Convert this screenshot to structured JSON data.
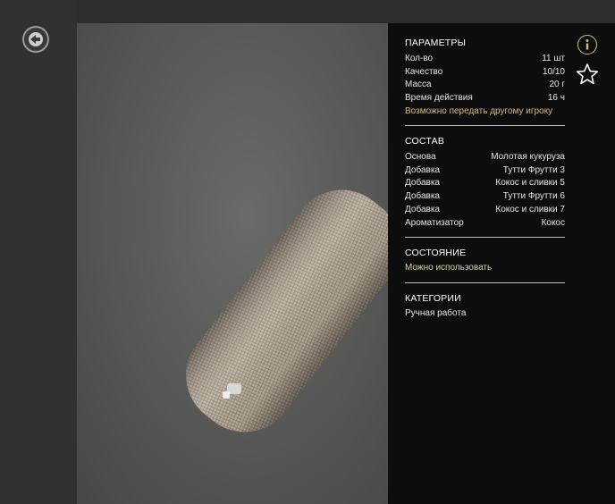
{
  "params": {
    "title": "ПАРАМЕТРЫ",
    "rows": [
      {
        "label": "Кол-во",
        "value": "11 шт"
      },
      {
        "label": "Качество",
        "value": "10/10"
      },
      {
        "label": "Масса",
        "value": "20 г"
      },
      {
        "label": "Время действия",
        "value": "16 ч"
      }
    ],
    "transfer_note": "Возможно передать другому игроку"
  },
  "composition": {
    "title": "СОСТАВ",
    "rows": [
      {
        "label": "Основа",
        "value": "Молотая кукуруза"
      },
      {
        "label": "Добавка",
        "value": "Тутти Фрутти 3"
      },
      {
        "label": "Добавка",
        "value": "Кокос и сливки 5"
      },
      {
        "label": "Добавка",
        "value": "Тутти Фрутти 6"
      },
      {
        "label": "Добавка",
        "value": "Кокос и сливки 7"
      },
      {
        "label": "Ароматизатор",
        "value": "Кокос"
      }
    ]
  },
  "state": {
    "title": "СОСТОЯНИЕ",
    "value": "Можно использовать"
  },
  "categories": {
    "title": "КАТЕГОРИИ",
    "value": "Ручная работа"
  },
  "colors": {
    "panel_bg": "#0d0d0d",
    "accent_note": "#d9b98a",
    "state_color": "#dcd2a2",
    "info_icon": "#c9c07a"
  },
  "icons": {
    "back": "back-arrow-icon",
    "info": "info-icon",
    "favorite": "star-outline-icon"
  }
}
